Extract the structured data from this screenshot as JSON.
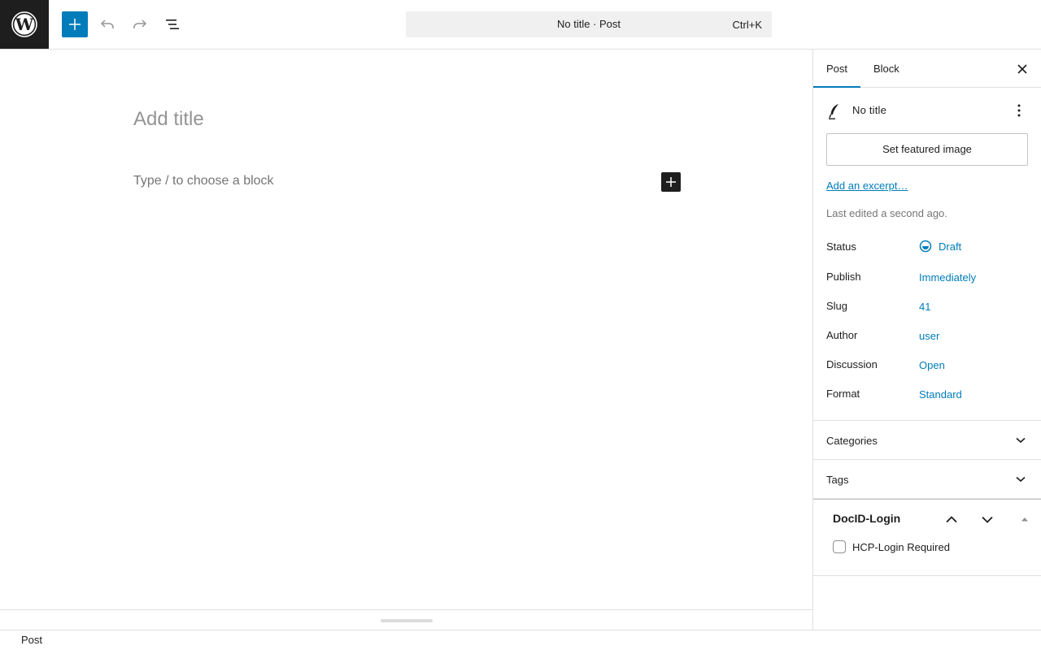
{
  "header": {
    "command_title": "No title · Post",
    "command_shortcut": "Ctrl+K"
  },
  "editor": {
    "title_placeholder": "Add title",
    "block_placeholder": "Type / to choose a block"
  },
  "footer": {
    "breadcrumb": "Post"
  },
  "sidebar": {
    "tabs": [
      {
        "label": "Post",
        "active": true
      },
      {
        "label": "Block",
        "active": false
      }
    ],
    "post_title": "No title",
    "featured_image_label": "Set featured image",
    "excerpt_link": "Add an excerpt…",
    "last_edited": "Last edited a second ago.",
    "rows": [
      {
        "label": "Status",
        "value": "Draft"
      },
      {
        "label": "Publish",
        "value": "Immediately"
      },
      {
        "label": "Slug",
        "value": "41"
      },
      {
        "label": "Author",
        "value": "user"
      },
      {
        "label": "Discussion",
        "value": "Open"
      },
      {
        "label": "Format",
        "value": "Standard"
      }
    ],
    "panels": [
      {
        "label": "Categories"
      },
      {
        "label": "Tags"
      }
    ],
    "metabox": {
      "title": "DocID-Login",
      "checkbox_label": "HCP-Login Required",
      "checked": false
    }
  },
  "colors": {
    "accent": "#007cba",
    "dark": "#1e1e1e",
    "border": "#e0e0e0"
  },
  "icons": {
    "logo": "wordpress-logo-icon",
    "add": "plus-icon",
    "undo": "undo-icon",
    "redo": "redo-icon",
    "list_view": "list-view-icon",
    "close": "close-icon",
    "post": "feather-icon",
    "more": "more-vertical-icon",
    "status": "draft-status-icon",
    "chevron": "chevron-down-icon"
  }
}
